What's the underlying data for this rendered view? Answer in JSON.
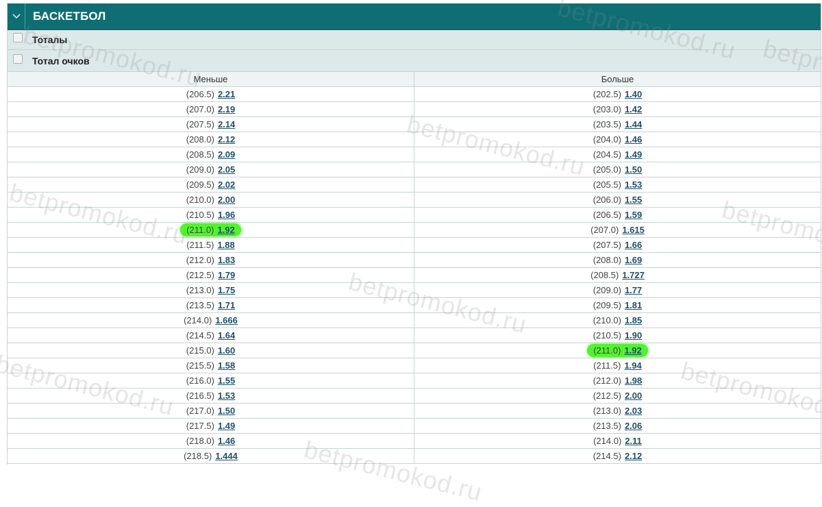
{
  "header": {
    "title": "БАСКЕТБОЛ",
    "toggle_icon": "chevron-down-icon"
  },
  "markets": [
    {
      "label": "Тоталы"
    },
    {
      "label": "Тотал очков"
    }
  ],
  "columns": {
    "under": "Меньше",
    "over": "Больше"
  },
  "rows": [
    {
      "under_line": "(206.5)",
      "under_odd": "2.21",
      "over_line": "(202.5)",
      "over_odd": "1.40"
    },
    {
      "under_line": "(207.0)",
      "under_odd": "2.19",
      "over_line": "(203.0)",
      "over_odd": "1.42"
    },
    {
      "under_line": "(207.5)",
      "under_odd": "2.14",
      "over_line": "(203.5)",
      "over_odd": "1.44"
    },
    {
      "under_line": "(208.0)",
      "under_odd": "2.12",
      "over_line": "(204.0)",
      "over_odd": "1.46"
    },
    {
      "under_line": "(208.5)",
      "under_odd": "2.09",
      "over_line": "(204.5)",
      "over_odd": "1.49"
    },
    {
      "under_line": "(209.0)",
      "under_odd": "2.05",
      "over_line": "(205.0)",
      "over_odd": "1.50"
    },
    {
      "under_line": "(209.5)",
      "under_odd": "2.02",
      "over_line": "(205.5)",
      "over_odd": "1.53"
    },
    {
      "under_line": "(210.0)",
      "under_odd": "2.00",
      "over_line": "(206.0)",
      "over_odd": "1.55"
    },
    {
      "under_line": "(210.5)",
      "under_odd": "1.96",
      "over_line": "(206.5)",
      "over_odd": "1.59"
    },
    {
      "under_line": "(211.0)",
      "under_odd": "1.92",
      "over_line": "(207.0)",
      "over_odd": "1.615",
      "under_highlight": true
    },
    {
      "under_line": "(211.5)",
      "under_odd": "1.88",
      "over_line": "(207.5)",
      "over_odd": "1.66"
    },
    {
      "under_line": "(212.0)",
      "under_odd": "1.83",
      "over_line": "(208.0)",
      "over_odd": "1.69"
    },
    {
      "under_line": "(212.5)",
      "under_odd": "1.79",
      "over_line": "(208.5)",
      "over_odd": "1.727"
    },
    {
      "under_line": "(213.0)",
      "under_odd": "1.75",
      "over_line": "(209.0)",
      "over_odd": "1.77"
    },
    {
      "under_line": "(213.5)",
      "under_odd": "1.71",
      "over_line": "(209.5)",
      "over_odd": "1.81"
    },
    {
      "under_line": "(214.0)",
      "under_odd": "1.666",
      "over_line": "(210.0)",
      "over_odd": "1.85"
    },
    {
      "under_line": "(214.5)",
      "under_odd": "1.64",
      "over_line": "(210.5)",
      "over_odd": "1.90"
    },
    {
      "under_line": "(215.0)",
      "under_odd": "1.60",
      "over_line": "(211.0)",
      "over_odd": "1.92",
      "over_highlight": true
    },
    {
      "under_line": "(215.5)",
      "under_odd": "1.58",
      "over_line": "(211.5)",
      "over_odd": "1.94"
    },
    {
      "under_line": "(216.0)",
      "under_odd": "1.55",
      "over_line": "(212.0)",
      "over_odd": "1.98"
    },
    {
      "under_line": "(216.5)",
      "under_odd": "1.53",
      "over_line": "(212.5)",
      "over_odd": "2.00"
    },
    {
      "under_line": "(217.0)",
      "under_odd": "1.50",
      "over_line": "(213.0)",
      "over_odd": "2.03"
    },
    {
      "under_line": "(217.5)",
      "under_odd": "1.49",
      "over_line": "(213.5)",
      "over_odd": "2.06"
    },
    {
      "under_line": "(218.0)",
      "under_odd": "1.46",
      "over_line": "(214.0)",
      "over_odd": "2.11"
    },
    {
      "under_line": "(218.5)",
      "under_odd": "1.444",
      "over_line": "(214.5)",
      "over_odd": "2.12"
    }
  ],
  "watermark": "betpromokod.ru",
  "colors": {
    "header_bg": "#0f6e74",
    "market_bg": "#dde8e9",
    "odd_link": "#1e4f6d",
    "highlight": "#52f22e"
  }
}
